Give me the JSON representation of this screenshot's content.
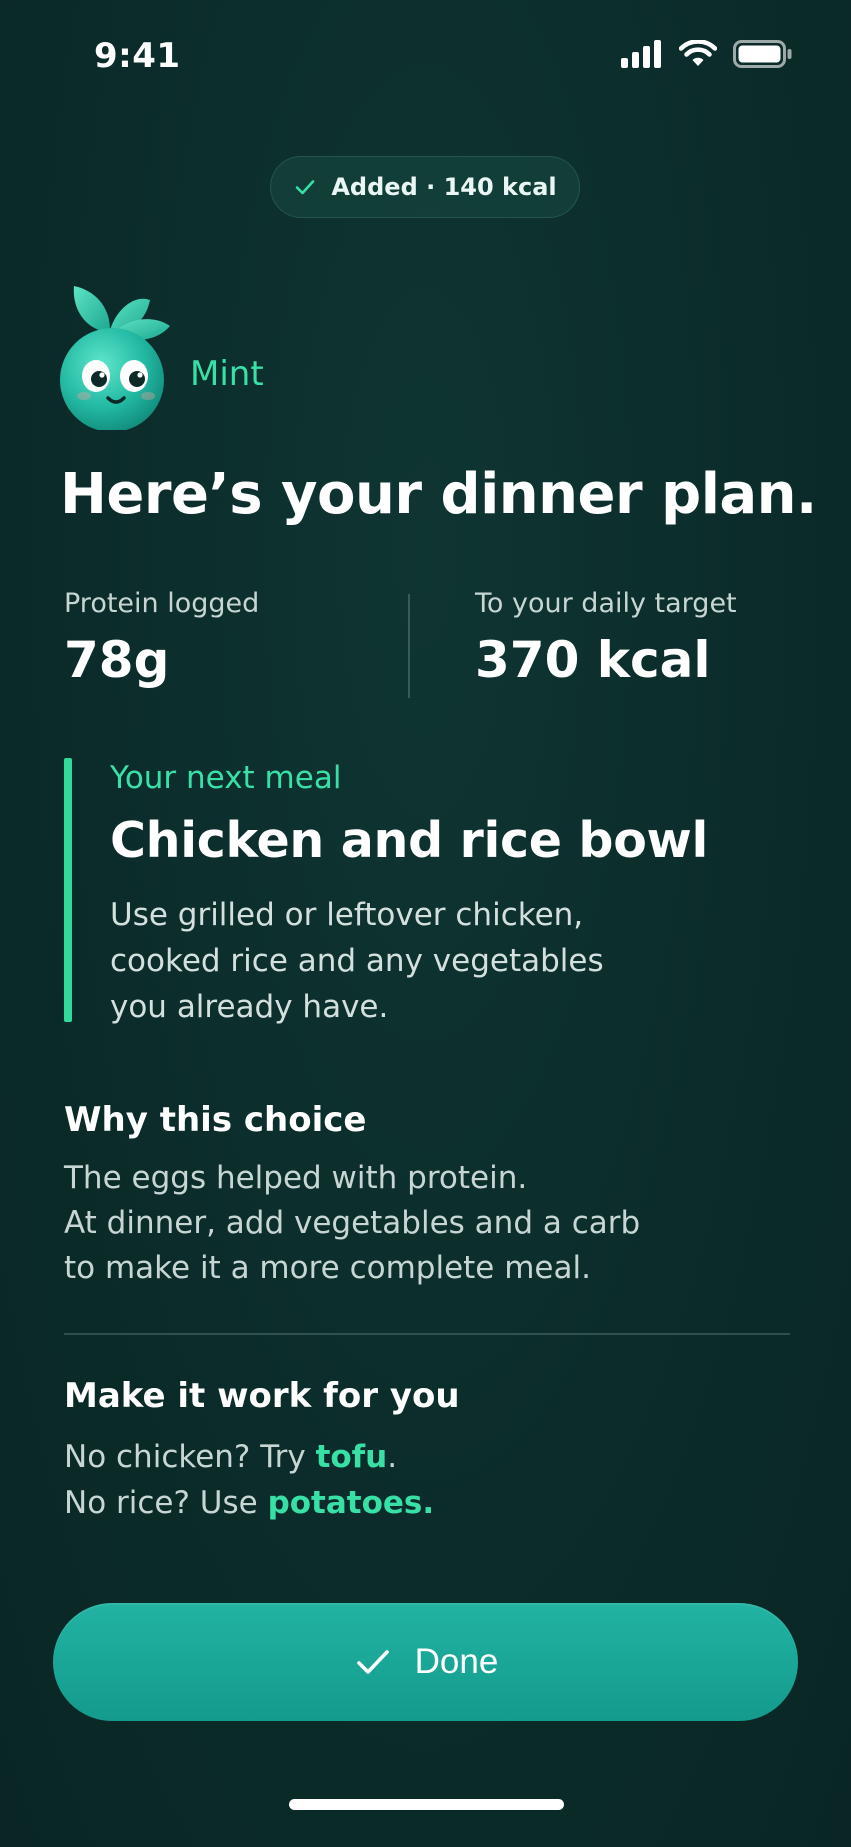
{
  "status_bar": {
    "time": "9:41"
  },
  "toast": {
    "text": "Added · 140 kcal",
    "icon": "check-icon"
  },
  "assistant": {
    "name": "Mint",
    "avatar_icon": "mint-mascot-icon"
  },
  "title": "Here’s your dinner plan.",
  "stats": {
    "protein": {
      "label": "Protein logged",
      "value": "78g"
    },
    "target": {
      "label": "To your daily target",
      "value": "370 kcal"
    }
  },
  "next_meal": {
    "eyebrow": "Your next meal",
    "title": "Chicken and rice bowl",
    "description_lines": [
      "Use grilled or leftover chicken,",
      "cooked rice and any vegetables",
      "you already have."
    ]
  },
  "why": {
    "title": "Why this choice",
    "lines": [
      "The eggs helped with protein.",
      "At dinner, add vegetables and a carb",
      "to make it a more complete meal."
    ]
  },
  "work": {
    "title": "Make it work for you",
    "line1_prefix": "No chicken? Try ",
    "line1_highlight": "tofu",
    "line1_suffix": ".",
    "line2_prefix": "No rice? Use ",
    "line2_highlight": "potatoes."
  },
  "done_button": {
    "label": "Done",
    "icon": "check-icon"
  },
  "colors": {
    "background": "#0b2c2a",
    "accent": "#39e0a6",
    "button": "#1aa898"
  }
}
